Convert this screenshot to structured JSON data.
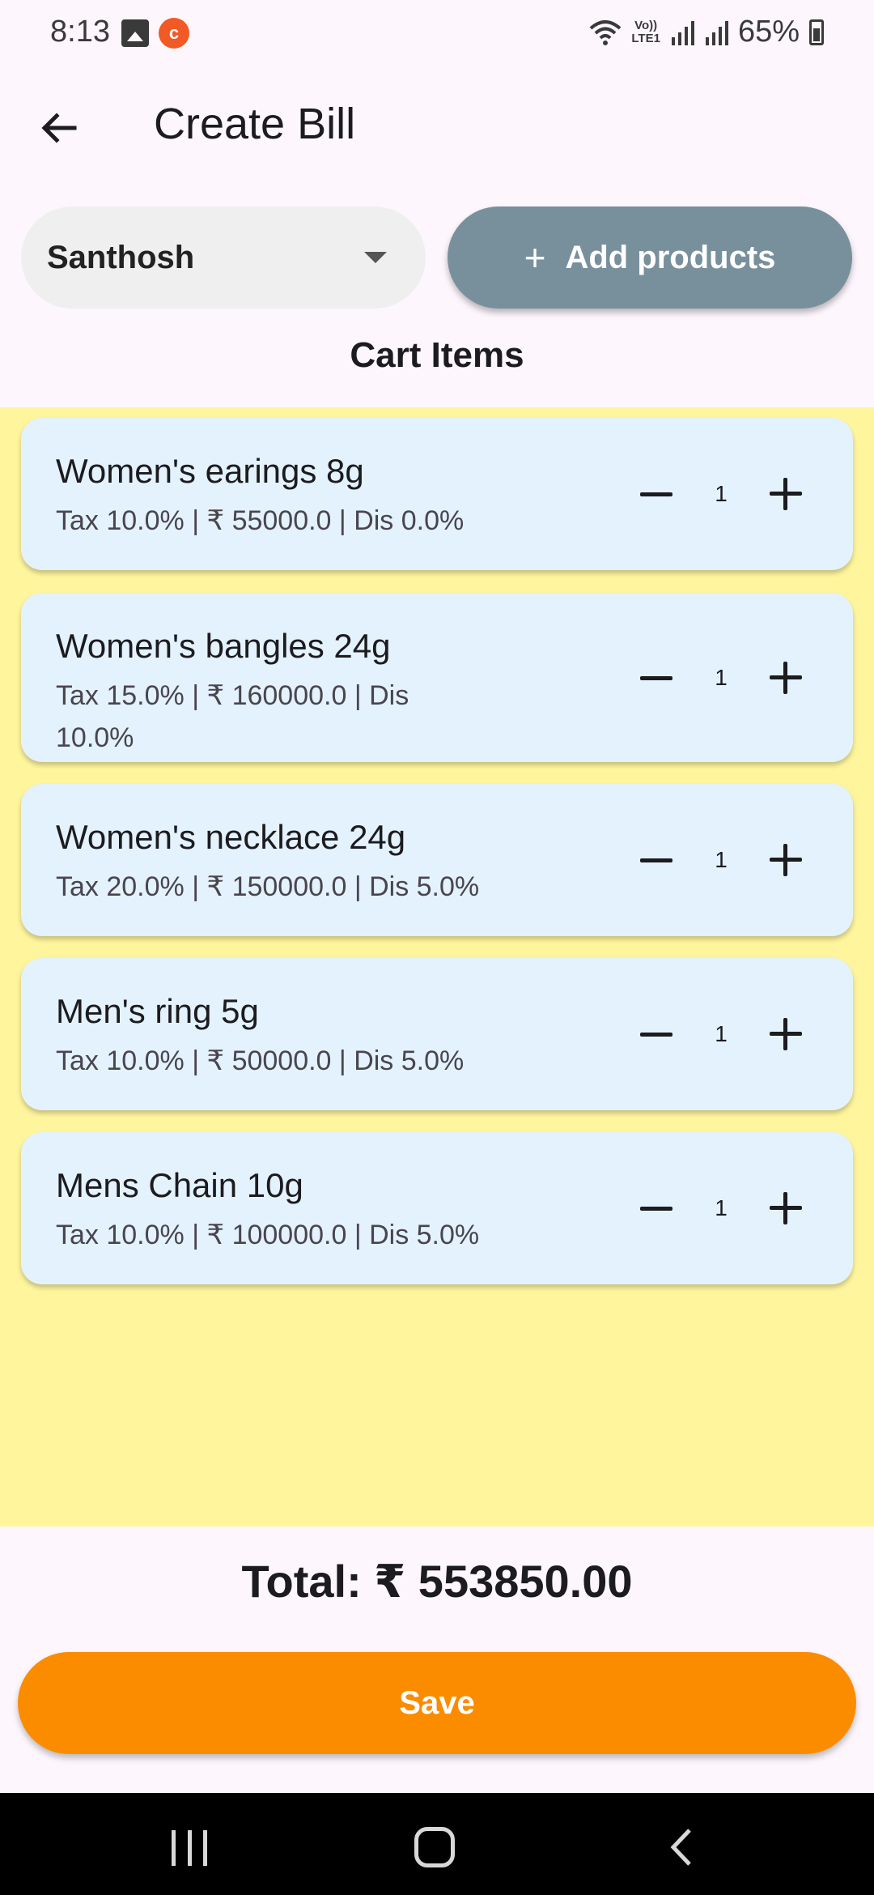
{
  "status_bar": {
    "time": "8:13",
    "network_label_1": "Vo))",
    "network_label_2": "LTE1",
    "battery": "65%",
    "icons": [
      "image-icon",
      "app-notification-icon",
      "wifi-icon",
      "signal-icon",
      "signal-icon",
      "battery-icon"
    ]
  },
  "app_bar": {
    "title": "Create Bill",
    "back_icon": "arrow-left-icon"
  },
  "controls": {
    "customer": "Santhosh",
    "add_products_label": "Add products",
    "add_icon": "plus-icon"
  },
  "cart": {
    "heading": "Cart Items",
    "items": [
      {
        "name": "Women's earings 8g",
        "details": "Tax 10.0% | ₹ 55000.0 | Dis 0.0%",
        "qty": "1"
      },
      {
        "name": "Women's bangles 24g",
        "details": "Tax 15.0% | ₹ 160000.0 | Dis 10.0%",
        "qty": "1"
      },
      {
        "name": "Women's necklace 24g",
        "details": "Tax 20.0% | ₹ 150000.0 | Dis 5.0%",
        "qty": "1"
      },
      {
        "name": "Men's ring 5g",
        "details": "Tax 10.0% | ₹ 50000.0 | Dis 5.0%",
        "qty": "1"
      },
      {
        "name": "Mens Chain 10g",
        "details": "Tax 10.0% | ₹ 100000.0 | Dis 5.0%",
        "qty": "1"
      }
    ]
  },
  "total": "Total: ₹ 553850.00",
  "save_label": "Save",
  "colors": {
    "background": "#fdf7fd",
    "cart_area": "#fff59d",
    "card": "#e3f2fd",
    "add_button": "#78909c",
    "save_button": "#fb8c00"
  }
}
